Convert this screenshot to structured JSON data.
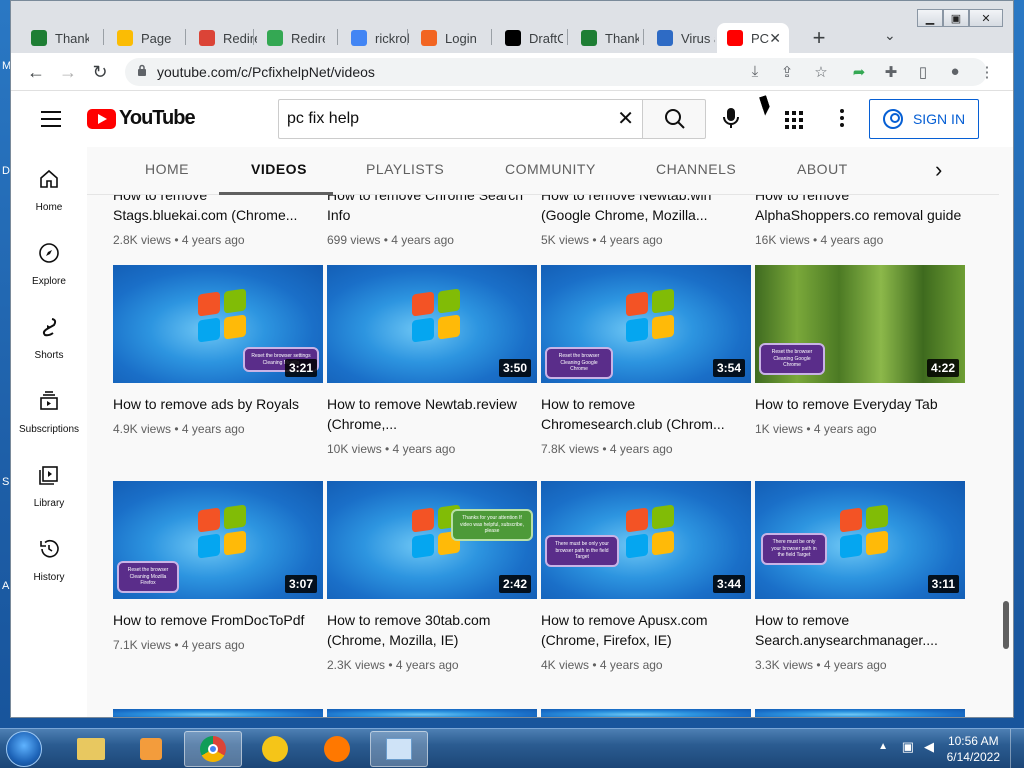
{
  "browser": {
    "tabs": [
      {
        "label": "Thank",
        "icon": "green-t-icon",
        "color": "#1e7e34"
      },
      {
        "label": "Page N",
        "icon": "google-drive-icon",
        "color": "#fbbc04"
      },
      {
        "label": "Redire",
        "icon": "chrome-icon",
        "color": "#db4437"
      },
      {
        "label": "Redire",
        "icon": "green-arrow-icon",
        "color": "#34a853"
      },
      {
        "label": "rickroll",
        "icon": "google-g-icon",
        "color": "#4285f4"
      },
      {
        "label": "Login S",
        "icon": "orange-logo-icon",
        "color": "#f26522"
      },
      {
        "label": "DraftC",
        "icon": "wikipedia-icon",
        "color": "#000000"
      },
      {
        "label": "Thank",
        "icon": "green-t-icon",
        "color": "#1e7e34"
      },
      {
        "label": "Virus a",
        "icon": "shield-icon",
        "color": "#2e6bc5"
      },
      {
        "label": "PC",
        "icon": "youtube-icon",
        "color": "#ff0000"
      }
    ],
    "url": "youtube.com/c/PcfixhelpNet/videos"
  },
  "youtube": {
    "logo_text": "YouTube",
    "search_value": "pc fix help",
    "signin_label": "SIGN IN",
    "guide": [
      {
        "label": "Home",
        "icon": "home-icon"
      },
      {
        "label": "Explore",
        "icon": "compass-icon"
      },
      {
        "label": "Shorts",
        "icon": "shorts-icon"
      },
      {
        "label": "Subscriptions",
        "icon": "subscriptions-icon"
      },
      {
        "label": "Library",
        "icon": "library-icon"
      },
      {
        "label": "History",
        "icon": "history-icon"
      }
    ],
    "channel_tabs": [
      "HOME",
      "VIDEOS",
      "PLAYLISTS",
      "COMMUNITY",
      "CHANNELS",
      "ABOUT"
    ],
    "active_tab": "VIDEOS",
    "videos_row0": [
      {
        "title": "How to remove Stags.bluekai.com (Chrome...",
        "meta": "2.8K views • 4 years ago"
      },
      {
        "title": "How to remove Chrome Search Info",
        "meta": "699 views • 4 years ago"
      },
      {
        "title": "How to remove Newtab.win (Google Chrome, Mozilla...",
        "meta": "5K views • 4 years ago"
      },
      {
        "title": "How to remove AlphaShoppers.co removal guide",
        "meta": "16K views • 4 years ago"
      }
    ],
    "videos_row1": [
      {
        "title": "How to remove ads by Royals",
        "meta": "4.9K views • 4 years ago",
        "duration": "3:21",
        "bubble": "Reset the browser settings Cleaning Mozilla"
      },
      {
        "title": "How to remove Newtab.review (Chrome,...",
        "meta": "10K views • 4 years ago",
        "duration": "3:50",
        "bubble": ""
      },
      {
        "title": "How to remove Chromesearch.club (Chrom...",
        "meta": "7.8K views • 4 years ago",
        "duration": "3:54",
        "bubble": "Reset the browser Cleaning Google Chrome"
      },
      {
        "title": "How to remove Everyday Tab",
        "meta": "1K views • 4 years ago",
        "duration": "4:22",
        "bubble": "Reset the browser Cleaning Google Chrome"
      }
    ],
    "videos_row2": [
      {
        "title": "How to remove FromDocToPdf",
        "meta": "7.1K views • 4 years ago",
        "duration": "3:07",
        "bubble": "Reset the browser Cleaning Mozilla Firefox"
      },
      {
        "title": "How to remove 30tab.com (Chrome, Mozilla, IE)",
        "meta": "2.3K views • 4 years ago",
        "duration": "2:42",
        "bubble": "Thanks for your attention If video was helpful, subscribe, please"
      },
      {
        "title": "How to remove Apusx.com (Chrome, Firefox, IE)",
        "meta": "4K views • 4 years ago",
        "duration": "3:44",
        "bubble": "There must be only your browser path in the field Target"
      },
      {
        "title": "How to remove Search.anysearchmanager....",
        "meta": "3.3K views • 4 years ago",
        "duration": "3:11",
        "bubble": "There must be only your browser path in the field Target"
      }
    ]
  },
  "taskbar": {
    "time": "10:56 AM",
    "date": "6/14/2022"
  }
}
